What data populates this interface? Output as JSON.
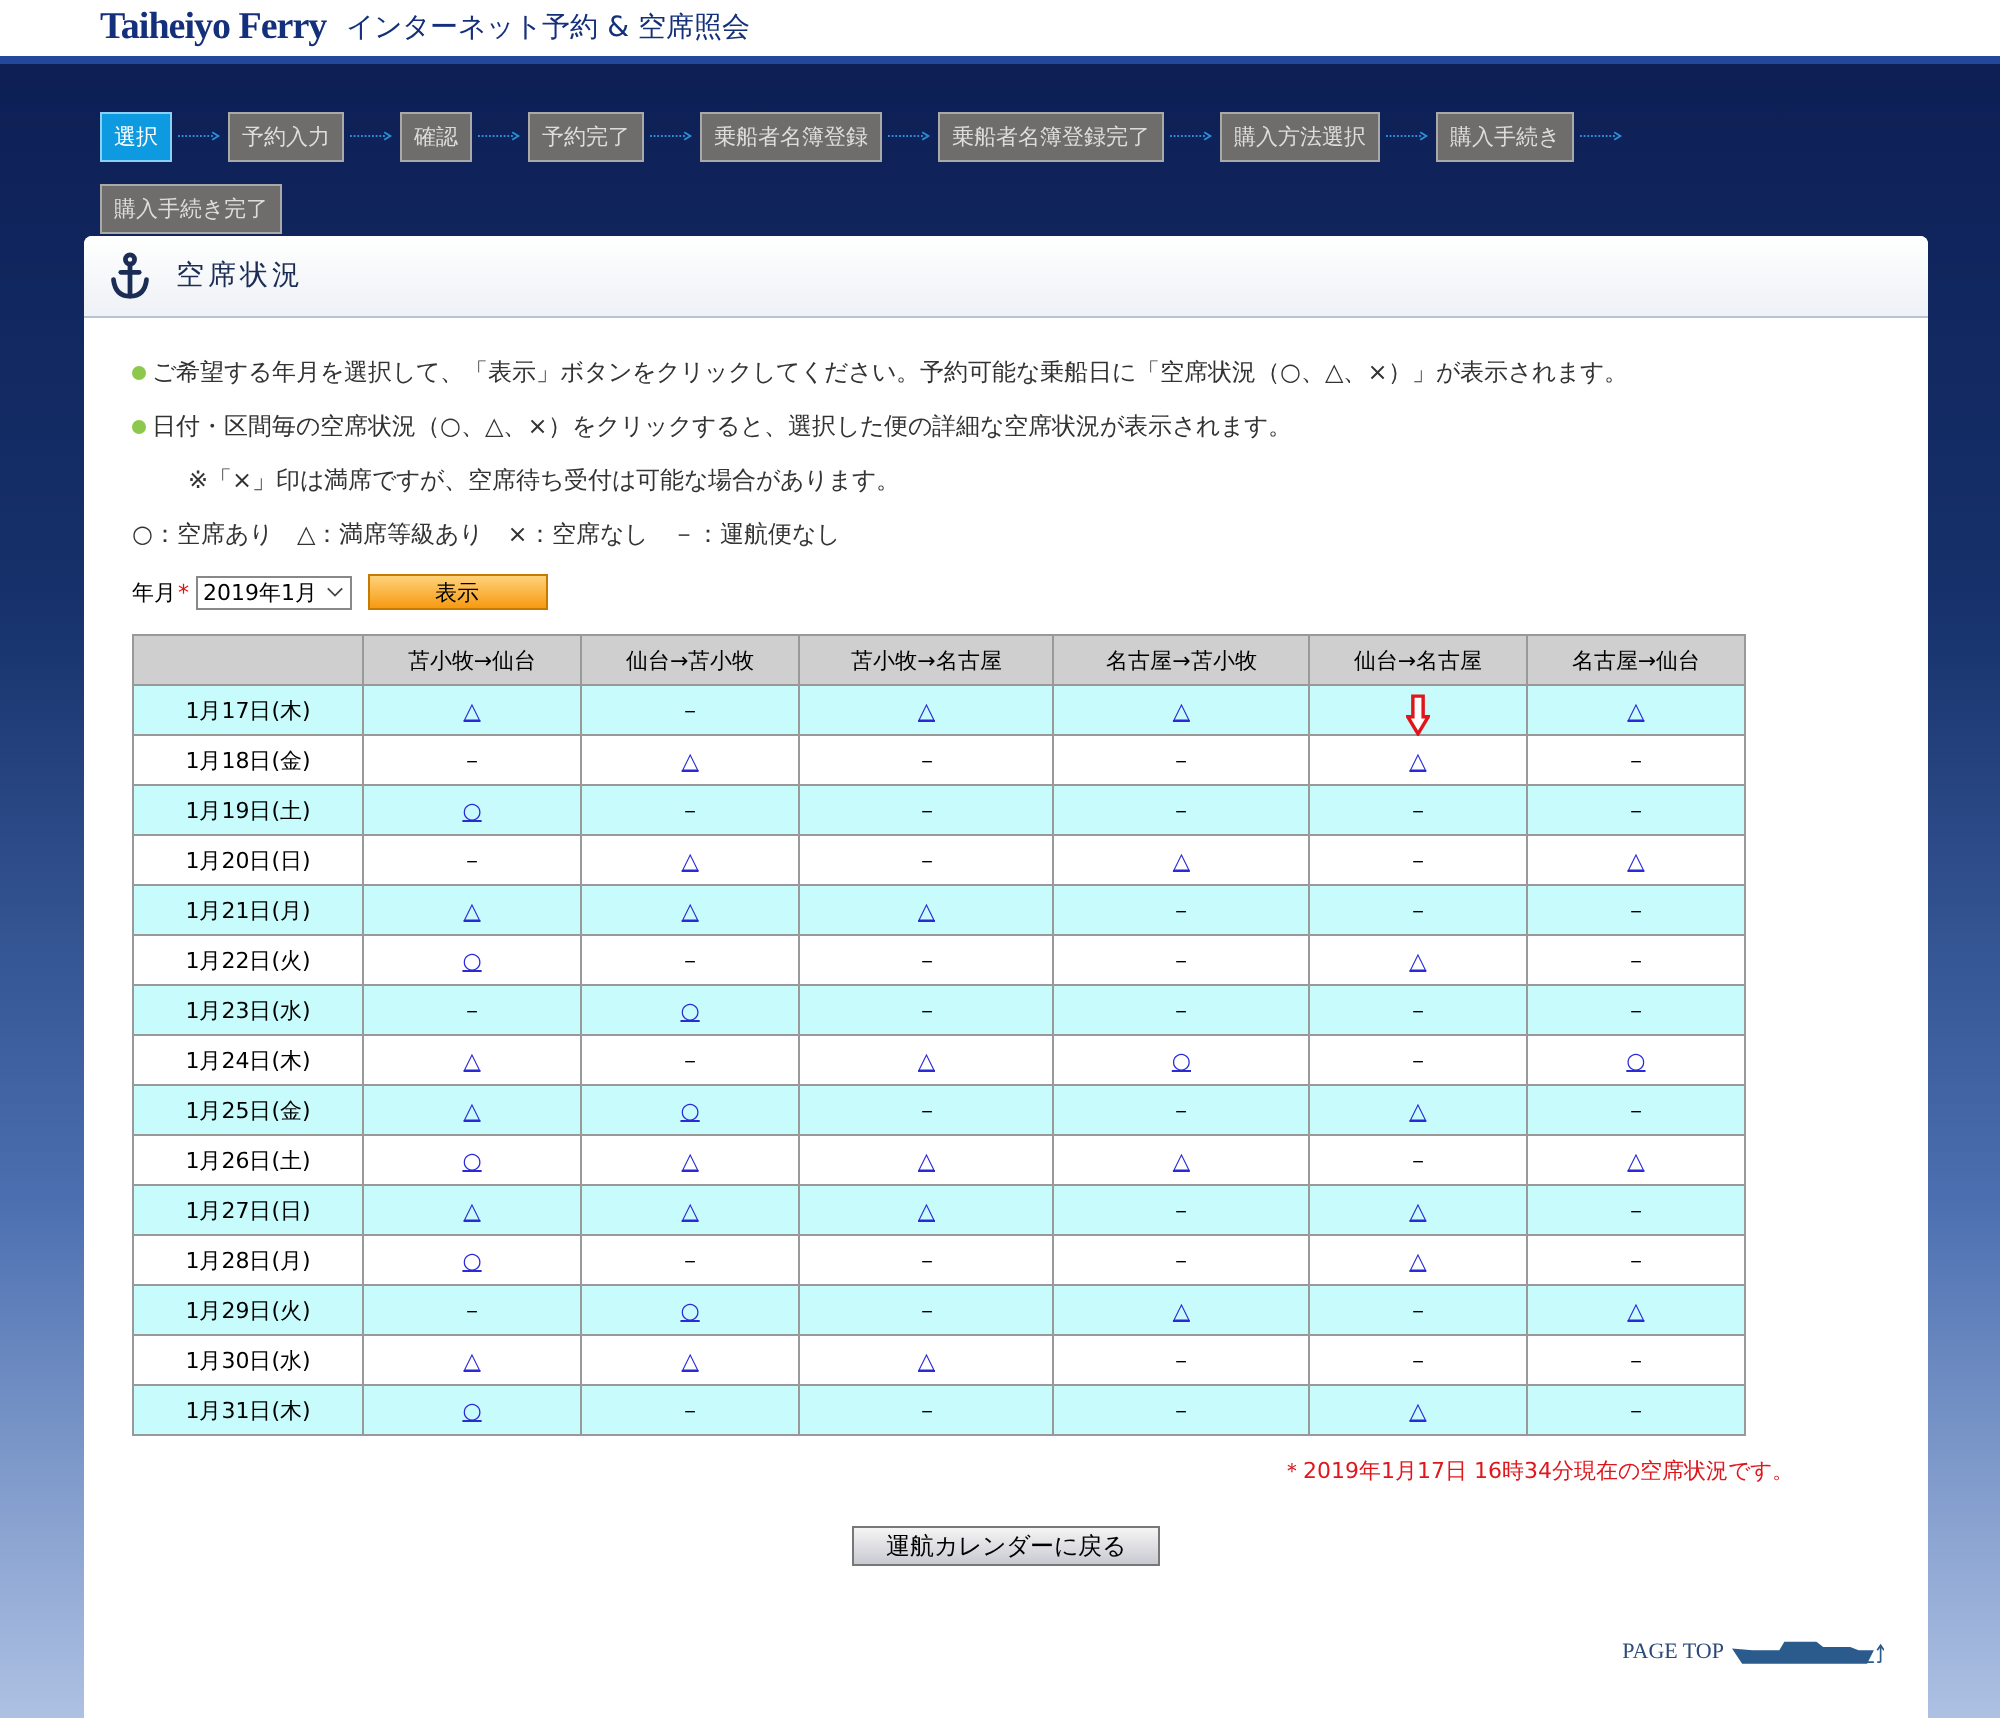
{
  "header": {
    "logo": "Taiheiyo Ferry",
    "title": "インターネット予約 & 空席照会"
  },
  "steps": [
    {
      "label": "選択",
      "selected": true
    },
    {
      "label": "予約入力",
      "selected": false
    },
    {
      "label": "確認",
      "selected": false
    },
    {
      "label": "予約完了",
      "selected": false
    },
    {
      "label": "乗船者名簿登録",
      "selected": false
    },
    {
      "label": "乗船者名簿登録完了",
      "selected": false
    },
    {
      "label": "購入方法選択",
      "selected": false
    },
    {
      "label": "購入手続き",
      "selected": false
    },
    {
      "label": "購入手続き完了",
      "selected": false
    }
  ],
  "panel": {
    "title": "空席状況",
    "notes": [
      {
        "kind": "bullet",
        "text": "ご希望する年月を選択して、「表示」ボタンをクリックしてください。予約可能な乗船日に「空席状況（○、△、×）」が表示されます。"
      },
      {
        "kind": "bullet",
        "text": "日付・区間毎の空席状況（○、△、×）をクリックすると、選択した便の詳細な空席状況が表示されます。"
      },
      {
        "kind": "indent",
        "text": "※「×」印は満席ですが、空席待ち受付は可能な場合があります。"
      },
      {
        "kind": "plain",
        "text": "○：空席あり　△：満席等級あり　×：空席なし　－：運航便なし"
      }
    ],
    "month_label": "年月",
    "required_mark": "*",
    "month_select": "2019年1月",
    "show_button": "表示",
    "columns": [
      "苫小牧→仙台",
      "仙台→苫小牧",
      "苫小牧→名古屋",
      "名古屋→苫小牧",
      "仙台→名古屋",
      "名古屋→仙台"
    ],
    "rows": [
      {
        "date": "1月17日(木)",
        "cells": [
          {
            "kind": "link",
            "text": "△"
          },
          {
            "kind": "text",
            "text": "－"
          },
          {
            "kind": "link",
            "text": "△"
          },
          {
            "kind": "link",
            "text": "△"
          },
          {
            "kind": "arrow"
          },
          {
            "kind": "link",
            "text": "△"
          }
        ]
      },
      {
        "date": "1月18日(金)",
        "cells": [
          {
            "kind": "text",
            "text": "－"
          },
          {
            "kind": "link",
            "text": "△"
          },
          {
            "kind": "text",
            "text": "－"
          },
          {
            "kind": "text",
            "text": "－"
          },
          {
            "kind": "link",
            "text": "△"
          },
          {
            "kind": "text",
            "text": "－"
          }
        ]
      },
      {
        "date": "1月19日(土)",
        "cells": [
          {
            "kind": "link",
            "text": "○"
          },
          {
            "kind": "text",
            "text": "－"
          },
          {
            "kind": "text",
            "text": "－"
          },
          {
            "kind": "text",
            "text": "－"
          },
          {
            "kind": "text",
            "text": "－"
          },
          {
            "kind": "text",
            "text": "－"
          }
        ]
      },
      {
        "date": "1月20日(日)",
        "cells": [
          {
            "kind": "text",
            "text": "－"
          },
          {
            "kind": "link",
            "text": "△"
          },
          {
            "kind": "text",
            "text": "－"
          },
          {
            "kind": "link",
            "text": "△"
          },
          {
            "kind": "text",
            "text": "－"
          },
          {
            "kind": "link",
            "text": "△"
          }
        ]
      },
      {
        "date": "1月21日(月)",
        "cells": [
          {
            "kind": "link",
            "text": "△"
          },
          {
            "kind": "link",
            "text": "△"
          },
          {
            "kind": "link",
            "text": "△"
          },
          {
            "kind": "text",
            "text": "－"
          },
          {
            "kind": "text",
            "text": "－"
          },
          {
            "kind": "text",
            "text": "－"
          }
        ]
      },
      {
        "date": "1月22日(火)",
        "cells": [
          {
            "kind": "link",
            "text": "○"
          },
          {
            "kind": "text",
            "text": "－"
          },
          {
            "kind": "text",
            "text": "－"
          },
          {
            "kind": "text",
            "text": "－"
          },
          {
            "kind": "link",
            "text": "△"
          },
          {
            "kind": "text",
            "text": "－"
          }
        ]
      },
      {
        "date": "1月23日(水)",
        "cells": [
          {
            "kind": "text",
            "text": "－"
          },
          {
            "kind": "link",
            "text": "○"
          },
          {
            "kind": "text",
            "text": "－"
          },
          {
            "kind": "text",
            "text": "－"
          },
          {
            "kind": "text",
            "text": "－"
          },
          {
            "kind": "text",
            "text": "－"
          }
        ]
      },
      {
        "date": "1月24日(木)",
        "cells": [
          {
            "kind": "link",
            "text": "△"
          },
          {
            "kind": "text",
            "text": "－"
          },
          {
            "kind": "link",
            "text": "△"
          },
          {
            "kind": "link",
            "text": "○"
          },
          {
            "kind": "text",
            "text": "－"
          },
          {
            "kind": "link",
            "text": "○"
          }
        ]
      },
      {
        "date": "1月25日(金)",
        "cells": [
          {
            "kind": "link",
            "text": "△"
          },
          {
            "kind": "link",
            "text": "○"
          },
          {
            "kind": "text",
            "text": "－"
          },
          {
            "kind": "text",
            "text": "－"
          },
          {
            "kind": "link",
            "text": "△"
          },
          {
            "kind": "text",
            "text": "－"
          }
        ]
      },
      {
        "date": "1月26日(土)",
        "cells": [
          {
            "kind": "link",
            "text": "○"
          },
          {
            "kind": "link",
            "text": "△"
          },
          {
            "kind": "link",
            "text": "△"
          },
          {
            "kind": "link",
            "text": "△"
          },
          {
            "kind": "text",
            "text": "－"
          },
          {
            "kind": "link",
            "text": "△"
          }
        ]
      },
      {
        "date": "1月27日(日)",
        "cells": [
          {
            "kind": "link",
            "text": "△"
          },
          {
            "kind": "link",
            "text": "△"
          },
          {
            "kind": "link",
            "text": "△"
          },
          {
            "kind": "text",
            "text": "－"
          },
          {
            "kind": "link",
            "text": "△"
          },
          {
            "kind": "text",
            "text": "－"
          }
        ]
      },
      {
        "date": "1月28日(月)",
        "cells": [
          {
            "kind": "link",
            "text": "○"
          },
          {
            "kind": "text",
            "text": "－"
          },
          {
            "kind": "text",
            "text": "－"
          },
          {
            "kind": "text",
            "text": "－"
          },
          {
            "kind": "link",
            "text": "△"
          },
          {
            "kind": "text",
            "text": "－"
          }
        ]
      },
      {
        "date": "1月29日(火)",
        "cells": [
          {
            "kind": "text",
            "text": "－"
          },
          {
            "kind": "link",
            "text": "○"
          },
          {
            "kind": "text",
            "text": "－"
          },
          {
            "kind": "link",
            "text": "△"
          },
          {
            "kind": "text",
            "text": "－"
          },
          {
            "kind": "link",
            "text": "△"
          }
        ]
      },
      {
        "date": "1月30日(水)",
        "cells": [
          {
            "kind": "link",
            "text": "△"
          },
          {
            "kind": "link",
            "text": "△"
          },
          {
            "kind": "link",
            "text": "△"
          },
          {
            "kind": "text",
            "text": "－"
          },
          {
            "kind": "text",
            "text": "－"
          },
          {
            "kind": "text",
            "text": "－"
          }
        ]
      },
      {
        "date": "1月31日(木)",
        "cells": [
          {
            "kind": "link",
            "text": "○"
          },
          {
            "kind": "text",
            "text": "－"
          },
          {
            "kind": "text",
            "text": "－"
          },
          {
            "kind": "text",
            "text": "－"
          },
          {
            "kind": "link",
            "text": "△"
          },
          {
            "kind": "text",
            "text": "－"
          }
        ]
      }
    ],
    "timestamp": "＊2019年1月17日 16時34分現在の空席状況です。",
    "back_button": "運航カレンダーに戻る",
    "page_top": "PAGE TOP"
  }
}
